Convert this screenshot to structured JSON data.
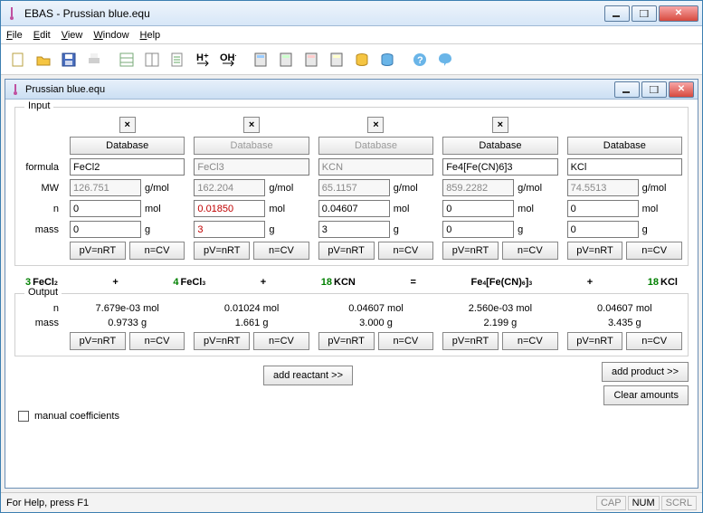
{
  "window": {
    "title": "EBAS - Prussian blue.equ"
  },
  "menu": {
    "file": "File",
    "edit": "Edit",
    "view": "View",
    "window": "Window",
    "help": "Help"
  },
  "doc": {
    "title": "Prussian blue.equ"
  },
  "labels": {
    "input": "Input",
    "output": "Output",
    "formula": "formula",
    "mw": "MW",
    "n": "n",
    "mass": "mass",
    "gmol": "g/mol",
    "mol": "mol",
    "g": "g",
    "database": "Database",
    "pvnrt": "pV=nRT",
    "ncv": "n=CV",
    "addReactant": "add reactant >>",
    "addProduct": "add product >>",
    "clear": "Clear amounts",
    "manual": "manual coefficients"
  },
  "species": [
    {
      "formula": "FeCl2",
      "mw": "126.751",
      "n": "0",
      "mass": "0",
      "dbEnabled": true,
      "removable": true,
      "coef": "3",
      "dispFormula": "FeCl",
      "sub": "2",
      "outN": "7.679e-03 mol",
      "outMass": "0.9733 g"
    },
    {
      "formula": "FeCl3",
      "mw": "162.204",
      "n": "0.01850",
      "nRed": true,
      "mass": "3",
      "massRed": true,
      "dbEnabled": false,
      "removable": true,
      "grayed": true,
      "coef": "4",
      "dispFormula": "FeCl",
      "sub": "3",
      "outN": "0.01024 mol",
      "outMass": "1.661 g"
    },
    {
      "formula": "KCN",
      "mw": "65.1157",
      "n": "0.04607",
      "mass": "3",
      "dbEnabled": false,
      "removable": true,
      "grayed": true,
      "coef": "18",
      "dispFormula": "KCN",
      "sub": "",
      "outN": "0.04607 mol",
      "outMass": "3.000 g"
    },
    {
      "formula": "Fe4[Fe(CN)6]3",
      "mw": "859.2282",
      "n": "0",
      "mass": "0",
      "dbEnabled": true,
      "removable": true,
      "coef": "",
      "dispFormula": "Fe",
      "sub": "4",
      "extra": "[Fe(CN)",
      "sub2": "6",
      "extra2": "]",
      "sub3": "3",
      "outN": "2.560e-03 mol",
      "outMass": "2.199 g"
    },
    {
      "formula": "KCl",
      "mw": "74.5513",
      "n": "0",
      "mass": "0",
      "dbEnabled": true,
      "removable": false,
      "coef": "18",
      "dispFormula": "KCl",
      "sub": "",
      "outN": "0.04607 mol",
      "outMass": "3.435 g"
    }
  ],
  "status": {
    "help": "For Help, press F1",
    "cap": "CAP",
    "num": "NUM",
    "scrl": "SCRL"
  }
}
